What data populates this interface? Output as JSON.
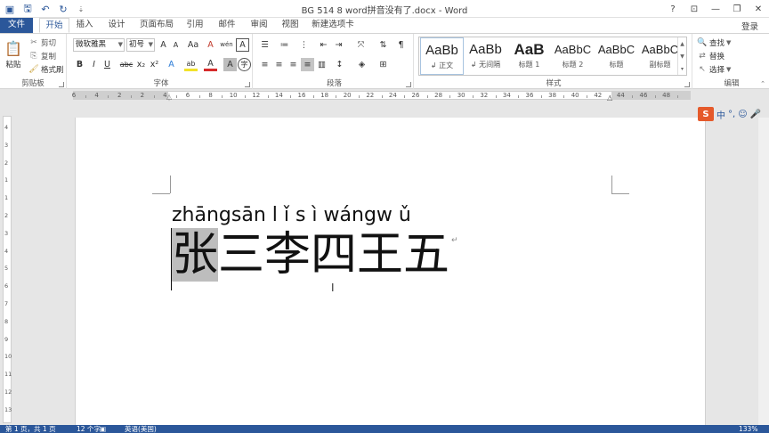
{
  "window": {
    "title": "BG 514 8 word拼音没有了.docx - Word",
    "controls": [
      "?",
      "⊡",
      "—",
      "❐",
      "✕"
    ]
  },
  "tabs": {
    "file": "文件",
    "items": [
      "开始",
      "插入",
      "设计",
      "页面布局",
      "引用",
      "邮件",
      "审阅",
      "视图",
      "新建选项卡"
    ],
    "signin": "登录"
  },
  "ribbon": {
    "clipboard": {
      "label": "剪贴板",
      "paste": "粘贴",
      "cut": "剪切",
      "copy": "复制",
      "format_painter": "格式刷"
    },
    "font": {
      "label": "字体",
      "font_name": "微软雅黑",
      "font_size": "初号",
      "grow": "A",
      "shrink": "A",
      "case": "Aa",
      "clear": "A",
      "phonetic": "wén",
      "border_char": "A",
      "bold": "B",
      "italic": "I",
      "underline": "U",
      "strike": "abc",
      "subscript": "x₂",
      "superscript": "x²",
      "text_effects": "A",
      "highlight": "ab",
      "font_color": "A",
      "char_shading": "A",
      "enclose": "字"
    },
    "paragraph": {
      "label": "段落"
    },
    "styles": {
      "label": "样式",
      "items": [
        {
          "sample": "AaBb",
          "name": "↲ 正文"
        },
        {
          "sample": "AaBb",
          "name": "↲ 无间隔"
        },
        {
          "sample": "AaB",
          "name": "标题 1"
        },
        {
          "sample": "AaBbC",
          "name": "标题 2"
        },
        {
          "sample": "AaBbC",
          "name": "标题"
        },
        {
          "sample": "AaBbC",
          "name": "副标题"
        }
      ]
    },
    "editing": {
      "label": "编辑",
      "find": "查找",
      "replace": "替换",
      "select": "选择"
    }
  },
  "ruler": {
    "numbers": [
      "6",
      "4",
      "2",
      "2",
      "4",
      "6",
      "8",
      "10",
      "12",
      "14",
      "16",
      "18",
      "20",
      "22",
      "24",
      "26",
      "28",
      "30",
      "32",
      "34",
      "36",
      "38",
      "40",
      "42",
      "44",
      "46",
      "48"
    ]
  },
  "vruler": {
    "numbers": [
      "4",
      "3",
      "2",
      "1",
      "1",
      "2",
      "3",
      "4",
      "5",
      "6",
      "7",
      "8",
      "9",
      "10",
      "11",
      "12",
      "13"
    ]
  },
  "document": {
    "pinyin": "zhāngsān l ǐ  s ì wángw ǔ",
    "chars": {
      "selected": "张",
      "rest": " 三李四王五"
    },
    "paragraph_mark": "↵"
  },
  "ime": {
    "logo": "S",
    "mode": "中",
    "punct": "°,",
    "emoji": "☺",
    "mic": "🎤"
  },
  "status": {
    "page": "第 1 页，共 1 页",
    "words": "12 个字",
    "language": "英语(美国)",
    "zoom": "133%"
  }
}
